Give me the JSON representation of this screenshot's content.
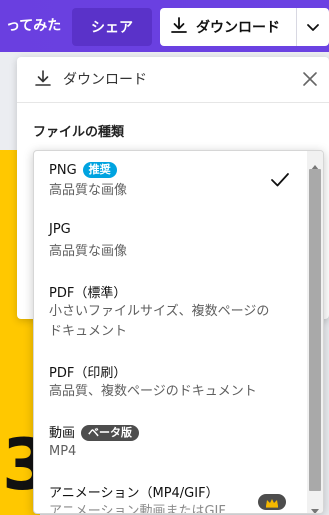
{
  "topbar": {
    "title": "ってみた",
    "share_label": "シェア",
    "download_label": "ダウンロード"
  },
  "panel": {
    "title": "ダウンロード",
    "file_type_label": "ファイルの種類"
  },
  "options": [
    {
      "title": "PNG",
      "badge": "推奨",
      "desc": "高品質な画像",
      "selected": true
    },
    {
      "title": "JPG",
      "desc": "高品質な画像"
    },
    {
      "title": "PDF（標準）",
      "desc": "小さいファイルサイズ、複数ページの",
      "desc2": "ドキュメント"
    },
    {
      "title": "PDF（印刷）",
      "desc": "高品質、複数ページのドキュメント"
    },
    {
      "title": "動画",
      "badge": "ベータ版",
      "desc": "MP4"
    },
    {
      "title": "アニメーション（MP4/GIF）",
      "desc": "アニメーション動画またはGIF"
    }
  ],
  "background_glyph": "3",
  "colors": {
    "topbar": "#6a3fe0",
    "accent_badge": "#00a3e0",
    "beta_badge": "#4d4d4d",
    "yellow": "#ffc800"
  }
}
